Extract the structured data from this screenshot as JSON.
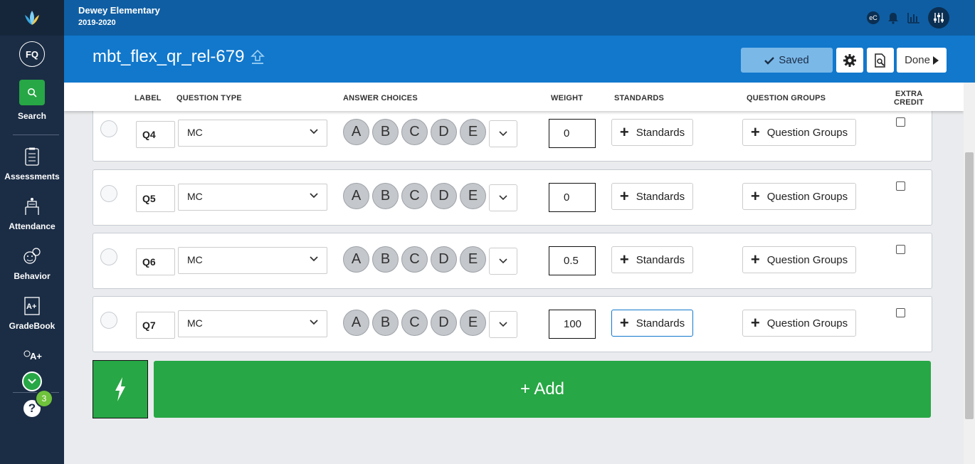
{
  "sidebar": {
    "avatar_initials": "FQ",
    "search_label": "Search",
    "items": [
      {
        "label": "Assessments",
        "icon": "assessments-icon"
      },
      {
        "label": "Attendance",
        "icon": "attendance-icon"
      },
      {
        "label": "Behavior",
        "icon": "behavior-icon"
      },
      {
        "label": "GradeBook",
        "icon": "gradebook-icon"
      },
      {
        "label": "Grades",
        "icon": "grades-icon"
      }
    ],
    "help_badge": "3"
  },
  "topbar": {
    "school": "Dewey Elementary",
    "year": "2019-2020",
    "ec_label": "eC"
  },
  "titlebar": {
    "title": "mbt_flex_qr_rel-679",
    "saved_label": "Saved",
    "done_label": "Done"
  },
  "columns": {
    "label": "LABEL",
    "question_type": "QUESTION TYPE",
    "answer_choices": "ANSWER CHOICES",
    "weight": "WEIGHT",
    "standards": "STANDARDS",
    "question_groups": "QUESTION GROUPS",
    "extra_credit_1": "EXTRA",
    "extra_credit_2": "CREDIT"
  },
  "questions": [
    {
      "label": "Q4",
      "type": "MC",
      "choices": [
        "A",
        "B",
        "C",
        "D",
        "E"
      ],
      "weight": "0",
      "standards_label": "Standards",
      "groups_label": "Question Groups",
      "extra_credit": false
    },
    {
      "label": "Q5",
      "type": "MC",
      "choices": [
        "A",
        "B",
        "C",
        "D",
        "E"
      ],
      "weight": "0",
      "standards_label": "Standards",
      "groups_label": "Question Groups",
      "extra_credit": false
    },
    {
      "label": "Q6",
      "type": "MC",
      "choices": [
        "A",
        "B",
        "C",
        "D",
        "E"
      ],
      "weight": "0.5",
      "standards_label": "Standards",
      "groups_label": "Question Groups",
      "extra_credit": false
    },
    {
      "label": "Q7",
      "type": "MC",
      "choices": [
        "A",
        "B",
        "C",
        "D",
        "E"
      ],
      "weight": "100",
      "standards_label": "Standards",
      "groups_label": "Question Groups",
      "extra_credit": false
    }
  ],
  "add_label": "+ Add",
  "colors": {
    "sidebar": "#1b2d45",
    "topbar": "#0f5ea3",
    "titlebar": "#1178cc",
    "accent_green": "#27a745",
    "saved_btn": "#7ab8e8"
  }
}
